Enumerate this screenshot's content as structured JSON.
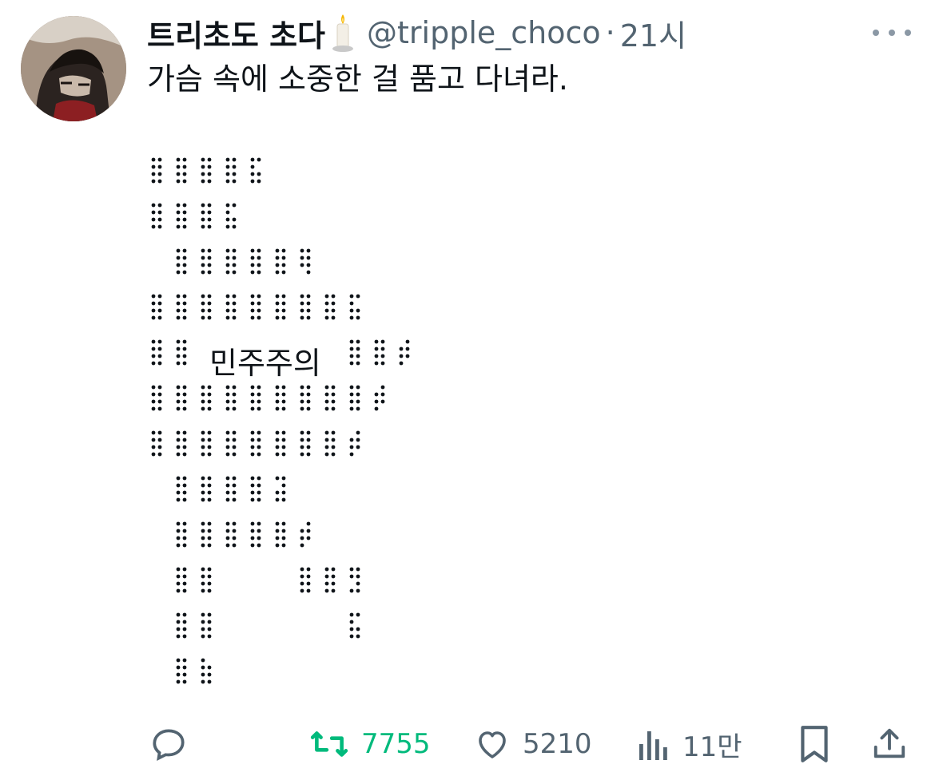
{
  "tweet": {
    "display_name": "트리초도 초다",
    "handle": "@tripple_choco",
    "separator": "·",
    "time": "21시",
    "text": "가슴 속에 소중한 걸 품고 다녀라.",
    "art_label": "민주주의",
    "art_icon": "braille-figure-art",
    "name_emoji": "candle-icon"
  },
  "actions": {
    "reply": {
      "icon": "reply-icon"
    },
    "retweet": {
      "icon": "retweet-icon",
      "count": "7755",
      "color": "#00ba7c"
    },
    "like": {
      "icon": "heart-icon",
      "count": "5210"
    },
    "views": {
      "icon": "views-icon",
      "count": "11만"
    },
    "bookmark": {
      "icon": "bookmark-icon"
    },
    "share": {
      "icon": "share-icon"
    }
  },
  "colors": {
    "text": "#0f1419",
    "secondary": "#536471",
    "retweet_green": "#00ba7c"
  }
}
